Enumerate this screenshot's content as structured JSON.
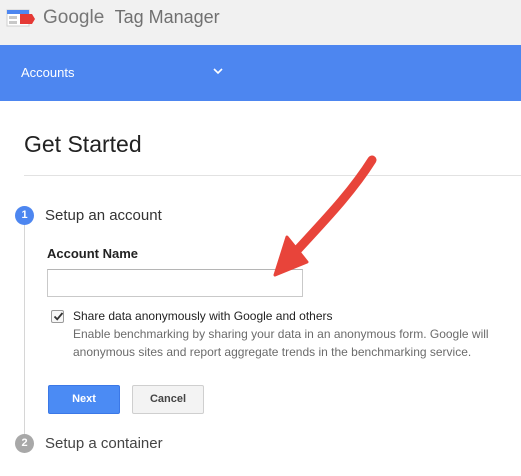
{
  "header": {
    "brand_google": "Google",
    "brand_product": "Tag Manager"
  },
  "nav": {
    "accounts_label": "Accounts"
  },
  "page": {
    "title": "Get Started"
  },
  "steps": [
    {
      "number": "1",
      "label": "Setup an account"
    },
    {
      "number": "2",
      "label": "Setup a container"
    }
  ],
  "form": {
    "account_name_label": "Account Name",
    "account_name_value": "",
    "share_label": "Share data anonymously with Google and others",
    "share_desc_line1": "Enable benchmarking by sharing your data in an anonymous form. Google will",
    "share_desc_line2": "anonymous sites and report aggregate trends in the benchmarking service.",
    "share_checked": true,
    "next_label": "Next",
    "cancel_label": "Cancel"
  },
  "colors": {
    "accent": "#4d86f0",
    "annotation_arrow": "#e8443a"
  },
  "icons": [
    "tag-manager-logo-icon",
    "chevron-down-icon",
    "checkmark-icon",
    "annotation-arrow"
  ]
}
